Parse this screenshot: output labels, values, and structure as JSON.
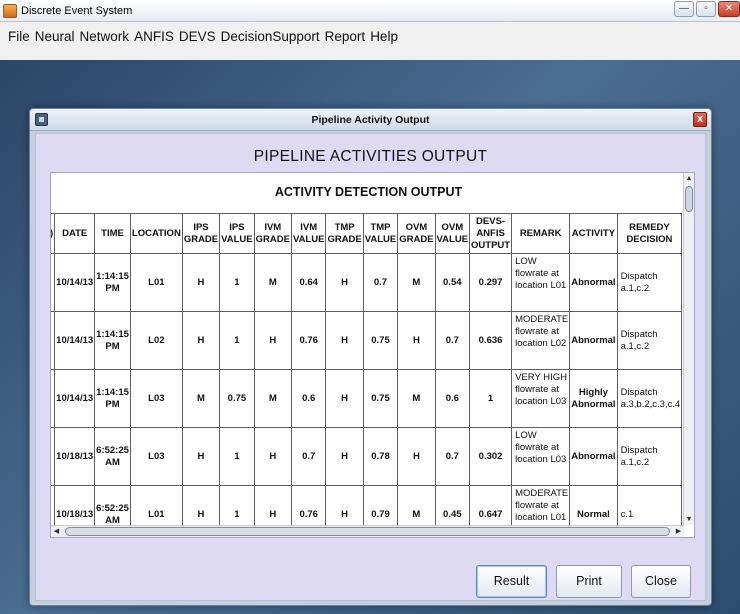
{
  "window": {
    "title": "Discrete Event System",
    "minimize_label": "—",
    "maximize_label": "▫",
    "close_label": "✕"
  },
  "menu": [
    "File",
    "Neural",
    "Network",
    "ANFIS",
    "DEVS",
    "DecisionSupport",
    "Report",
    "Help"
  ],
  "frame": {
    "title": "Pipeline Activity Output",
    "close_label": "x"
  },
  "heading": "PIPELINE ACTIVITIES OUTPUT",
  "subheading": "ACTIVITY DETECTION OUTPUT",
  "table": {
    "first_col_fragment": ")",
    "headers": [
      "DATE",
      "TIME",
      "LOCATION",
      "IPS GRADE",
      "IPS VALUE",
      "IVM GRADE",
      "IVM VALUE",
      "TMP GRADE",
      "TMP VALUE",
      "OVM GRADE",
      "OVM VALUE",
      "DEVS-ANFIS OUTPUT",
      "REMARK",
      "ACTIVITY",
      "REMEDY DECISION"
    ],
    "rows": [
      [
        "10/14/13",
        "1:14:15 PM",
        "L01",
        "H",
        "1",
        "M",
        "0.64",
        "H",
        "0.7",
        "M",
        "0.54",
        "0.297",
        "LOW flowrate at location L01",
        "Abnormal",
        "Dispatch a.1,c.2"
      ],
      [
        "10/14/13",
        "1:14:15 PM",
        "L02",
        "H",
        "1",
        "H",
        "0.76",
        "H",
        "0.75",
        "H",
        "0.7",
        "0.636",
        "MODERATE flowrate at location L02",
        "Abnormal",
        "Dispatch a.1,c.2"
      ],
      [
        "10/14/13",
        "1:14:15 PM",
        "L03",
        "M",
        "0.75",
        "M",
        "0.6",
        "H",
        "0.75",
        "M",
        "0.6",
        "1",
        "VERY HIGH flowrate at location L03",
        "Highly Abnormal",
        "Dispatch a.3,b.2,c.3,c.4"
      ],
      [
        "10/18/13",
        "6:52:25 AM",
        "L03",
        "H",
        "1",
        "H",
        "0.7",
        "H",
        "0.78",
        "H",
        "0.7",
        "0.302",
        "LOW flowrate at location L03",
        "Abnormal",
        "Dispatch a.1,c.2"
      ],
      [
        "10/18/13",
        "6:52:25 AM",
        "L01",
        "H",
        "1",
        "H",
        "0.76",
        "H",
        "0.79",
        "M",
        "0.45",
        "0.647",
        "MODERATE flowrate at location L01",
        "Normal",
        "c.1"
      ]
    ]
  },
  "buttons": {
    "result": "Result",
    "print": "Print",
    "close": "Close"
  }
}
